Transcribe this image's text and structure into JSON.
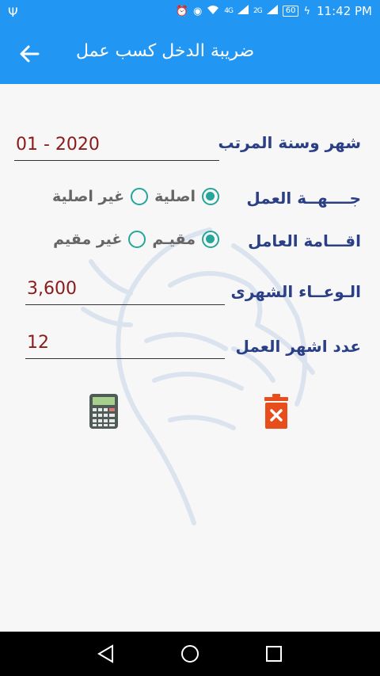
{
  "status_bar": {
    "usb_icon": "usb-icon",
    "network_1": "4G",
    "network_2": "2G",
    "battery": "60",
    "time": "11:42 PM"
  },
  "app_bar": {
    "title": "ضريبة الدخل كسب عمل"
  },
  "form": {
    "month_year_label": "شهر وسنة المرتب",
    "month_year_value": "01 - 2020",
    "work_side_label": "جــــهــة العمل",
    "work_side_options": [
      "اصلية",
      "غير اصلية"
    ],
    "work_side_selected": "اصلية",
    "residency_label": "اقـــامة العامل",
    "residency_options": [
      "مقيـم",
      "غير مقيم"
    ],
    "residency_selected": "مقيـم",
    "monthly_pool_label": "الـوعــاء الشهرى",
    "monthly_pool_value": "3,600",
    "work_months_label": "عدد اشهر العمل",
    "work_months_value": "12"
  },
  "actions": {
    "calculate_icon": "calculator-icon",
    "clear_icon": "trash-icon"
  },
  "colors": {
    "primary": "#2196f3",
    "label": "#2b3f86",
    "value": "#8b1a1a",
    "radio": "#26a69a",
    "delete": "#e84e1c"
  }
}
